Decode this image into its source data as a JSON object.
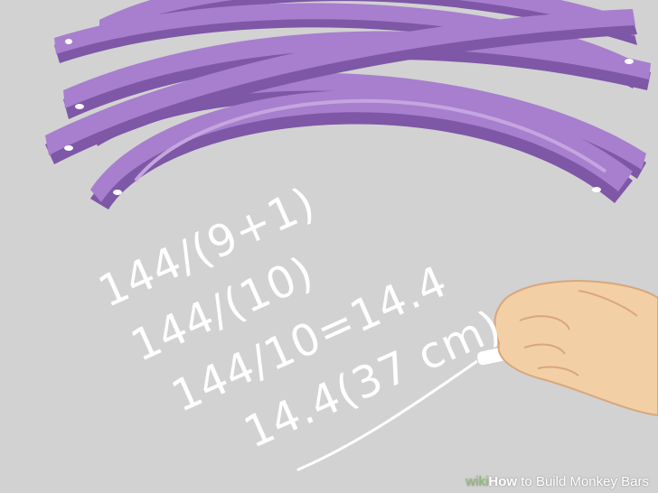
{
  "colors": {
    "background": "#d2d2d2",
    "bar_fill": "#a77fce",
    "bar_shadow": "#7e57a6",
    "bar_highlight": "#c5a5e0",
    "chalk": "#ffffff",
    "skin": "#f3cfa5",
    "skin_shadow": "#d8a77d"
  },
  "chalk_lines": [
    "144/(9+1)",
    "144/(10)",
    "144/10=14.4",
    "14.4(37 cm)"
  ],
  "icons": {
    "hand": "hand-holding-chalk-icon",
    "chalk": "chalk-stick-icon"
  },
  "watermark": {
    "prefix": "wiki",
    "brand": "How",
    "title": " to Build Monkey Bars"
  }
}
